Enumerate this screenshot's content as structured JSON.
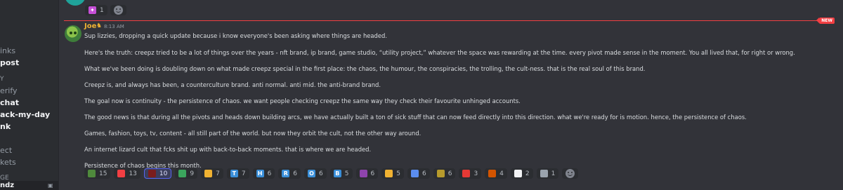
{
  "sidebar": {
    "items": [
      {
        "label": "inks"
      },
      {
        "label": "post"
      },
      {
        "label": "Y"
      },
      {
        "label": "erify"
      },
      {
        "label": "chat"
      },
      {
        "label": "ack-my-day"
      },
      {
        "label": "nk"
      },
      {
        "label": "ect"
      },
      {
        "label": "kets"
      },
      {
        "label": "GE"
      },
      {
        "label": "ndz"
      }
    ]
  },
  "previous_message": {
    "text": "...",
    "reactions": [
      {
        "count": "1"
      }
    ]
  },
  "new_badge": "NEW",
  "message": {
    "author": "Joe",
    "timestamp": "8:13 AM",
    "paragraphs": [
      "Sup lizzies, dropping a quick update because i know everyone's been asking where things are headed.",
      "Here's the truth: creepz tried to be a lot of things over the years - nft brand, ip brand, game studio, “utility project,” whatever the space was rewarding at the time. every pivot made sense in the moment. You all lived that, for right or wrong.",
      "What we've been doing is doubling down on what made creepz special in the first place: the chaos, the humour, the conspiracies, the trolling, the cult-ness. that is the real soul of this brand.",
      "Creepz is, and always has been, a counterculture brand. anti normal. anti mid. the anti-brand brand.",
      "The goal now is continuity - the persistence of chaos. we want people checking creepz the same way they check their favourite unhinged accounts.",
      "The good news is that during all the pivots and heads down building arcs, we have actually built a ton of sick stuff that can now feed directly into this direction. what we're ready for is motion. hence, the persistence of chaos.",
      "Games, fashion, toys, tv, content - all still part of the world. but now they orbit the cult, not the other way around.",
      "An internet lizard cult that fcks shit up with back-to-back moments. that is where we are headed.",
      "Persistence of chaos begins this month."
    ],
    "reactions": [
      {
        "emoji": "lizard-emoji",
        "count": "15",
        "color": "#4f8a3c"
      },
      {
        "emoji": "heart-emoji",
        "count": "13",
        "color": "#f23f43"
      },
      {
        "emoji": "skull-emoji",
        "count": "10",
        "color": "#7a1d1d",
        "selected": true
      },
      {
        "emoji": "green-lizard-emoji",
        "count": "9",
        "color": "#3ba55d"
      },
      {
        "emoji": "fist-emoji",
        "count": "7",
        "color": "#f0b232"
      },
      {
        "emoji": "letter-t-emoji",
        "count": "7",
        "color": "#3a8fd9",
        "glyph": "T"
      },
      {
        "emoji": "letter-h-emoji",
        "count": "6",
        "color": "#3a8fd9",
        "glyph": "H"
      },
      {
        "emoji": "letter-r-emoji",
        "count": "6",
        "color": "#3a8fd9",
        "glyph": "R"
      },
      {
        "emoji": "letter-o-emoji",
        "count": "6",
        "color": "#3a8fd9",
        "glyph": "O"
      },
      {
        "emoji": "letter-b-emoji",
        "count": "5",
        "color": "#3a8fd9",
        "glyph": "B"
      },
      {
        "emoji": "eggplant-emoji",
        "count": "6",
        "color": "#8e44ad"
      },
      {
        "emoji": "smirk-emoji",
        "count": "5",
        "color": "#f0b232"
      },
      {
        "emoji": "syringe-emoji",
        "count": "6",
        "color": "#5b8def"
      },
      {
        "emoji": "croc-emoji",
        "count": "6",
        "color": "#b79b2c"
      },
      {
        "emoji": "canada-flag-emoji",
        "count": "3",
        "color": "#e53935"
      },
      {
        "emoji": "mushroom-emoji",
        "count": "4",
        "color": "#d35400"
      },
      {
        "emoji": "england-flag-emoji",
        "count": "2",
        "color": "#f2f3f5"
      },
      {
        "emoji": "rocket-emoji",
        "count": "1",
        "color": "#9aa3ad"
      }
    ]
  }
}
